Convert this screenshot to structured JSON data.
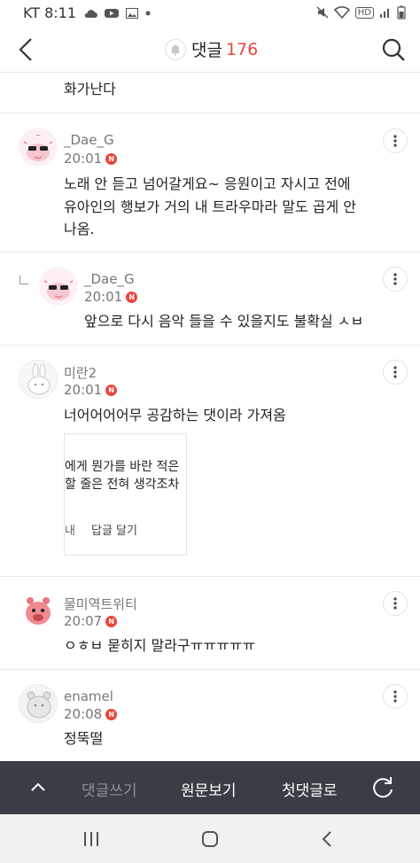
{
  "status_bar": {
    "carrier_time": "KT 8:11",
    "hd": "HD"
  },
  "header": {
    "title": "댓글",
    "count": "176"
  },
  "comments": [
    {
      "text": "화가난다"
    },
    {
      "user": "_Dae_G",
      "time": "20:01",
      "text_line1": "노래 안 듣고 넘어갈게요~ 응원이고 자시고 전에",
      "text_line2": "유아인의 행보가 거의 내 트라우마라 말도 곱게 안",
      "text_line3": "나옴."
    },
    {
      "user": "_Dae_G",
      "time": "20:01",
      "text": "앞으로 다시 음악 들을 수 있을지도 불확실 ㅅㅂ"
    },
    {
      "user": "미란2",
      "time": "20:01",
      "text": "너어어어어무 공감하는 댓이라 가져옴"
    },
    {
      "user": "물미역트위티",
      "time": "20:07",
      "text": "ㅇㅎㅂ 묻히지 말라구ㅠㅠㅠㅠㅠ"
    },
    {
      "user": "enamel",
      "time": "20:08",
      "text": "정뚝떨"
    }
  ],
  "embed": {
    "line1": "에게 뭔가를 바란 적은",
    "line2": "할 줄은 전혀 생각조차",
    "line3": "내",
    "reply": "답글 달기"
  },
  "badge": {
    "new": "N"
  },
  "bottom_bar": {
    "write": "댓글쓰기",
    "original": "원문보기",
    "first": "첫댓글로"
  },
  "colors": {
    "accent": "#e8473d",
    "bottom_bar": "#3a3d45"
  }
}
